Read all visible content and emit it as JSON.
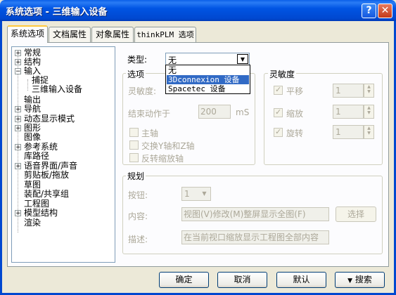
{
  "window": {
    "title": "系统选项 - 三维输入设备"
  },
  "tabs": [
    {
      "label": "系统选项"
    },
    {
      "label": "文档属性"
    },
    {
      "label": "对象属性"
    },
    {
      "label": "thinkPLM 选项"
    }
  ],
  "tree": {
    "items": [
      {
        "label": "常规"
      },
      {
        "label": "结构"
      },
      {
        "label": "输入"
      },
      {
        "label": "捕捉"
      },
      {
        "label": "三维输入设备"
      },
      {
        "label": "输出"
      },
      {
        "label": "导航"
      },
      {
        "label": "动态显示模式"
      },
      {
        "label": "图形"
      },
      {
        "label": "图像"
      },
      {
        "label": "参考系统"
      },
      {
        "label": "库路径"
      },
      {
        "label": "语音界面/声音"
      },
      {
        "label": "剪贴板/拖放"
      },
      {
        "label": "草图"
      },
      {
        "label": "装配/共享组"
      },
      {
        "label": "工程图"
      },
      {
        "label": "模型结构"
      },
      {
        "label": "渲染"
      }
    ]
  },
  "type_field": {
    "label": "类型:",
    "value": "无",
    "options": [
      "无",
      "3Dconnexion 设备",
      "Spacetec 设备"
    ]
  },
  "options_group": {
    "title": "选项",
    "sensitivity_label": "灵敏度:",
    "end_action_label": "结束动作于",
    "end_action_value": "200",
    "end_action_unit": "mS",
    "main_axis_label": "主轴",
    "swap_axis_label": "交换Y轴和Z轴",
    "reverse_zoom_label": "反转缩放轴"
  },
  "sensitivity_group": {
    "title": "灵敏度",
    "pan_label": "平移",
    "pan_value": "1",
    "zoom_label": "缩放",
    "zoom_value": "1",
    "rotate_label": "旋转",
    "rotate_value": "1"
  },
  "plan_group": {
    "title": "规划",
    "button_label": "按钮:",
    "button_value": "1",
    "content_label": "内容:",
    "content_value": "视图(V)修改(M)整屏显示全图(F)",
    "select_button": "选择",
    "desc_label": "描述:",
    "desc_value": "在当前视口缩放显示工程图全部内容"
  },
  "footer": {
    "ok": "确定",
    "cancel": "取消",
    "default": "默认",
    "search": "搜索"
  }
}
